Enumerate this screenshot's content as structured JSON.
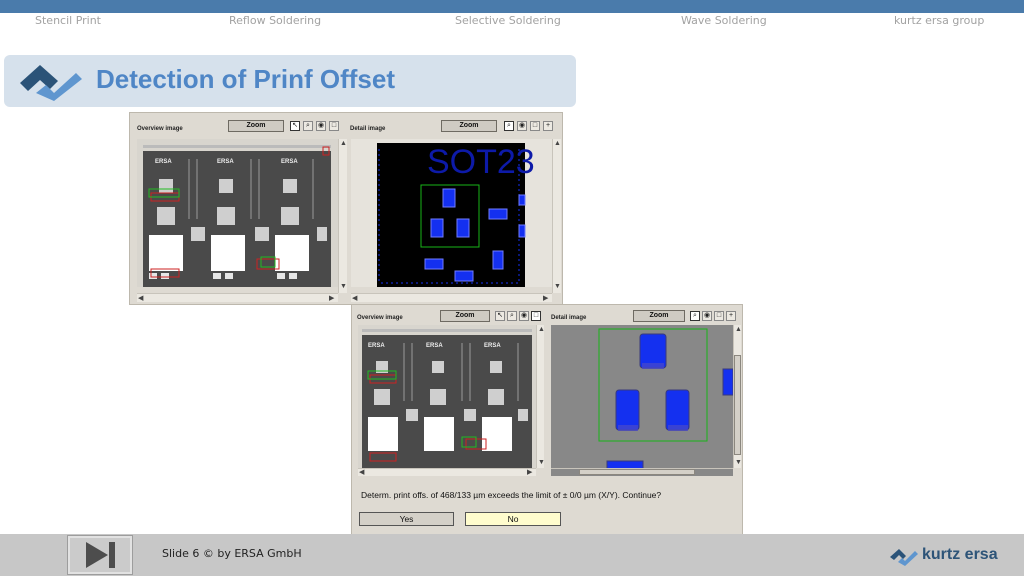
{
  "nav": {
    "items": [
      "Stencil Print",
      "Reflow Soldering",
      "Selective Soldering",
      "Wave Soldering",
      "kurtz ersa group"
    ]
  },
  "title": "Detection of Prinf Offset",
  "panel_top": {
    "overview_label": "Overview image",
    "detail_label": "Detail image",
    "zoom_label": "Zoom",
    "detail_text": "SOT23"
  },
  "panel_bottom": {
    "overview_label": "Overview image",
    "detail_label": "Detail image",
    "zoom_label": "Zoom",
    "message": "Determ. print offs. of 468/133 µm exceeds the limit of ± 0/0 µm (X/Y). Continue?",
    "yes_label": "Yes",
    "no_label": "No"
  },
  "board": {
    "brand_label": "ERSA"
  },
  "footer": {
    "slide_text": "Slide  6 © by ERSA GmbH",
    "brand": "kurtz ersa"
  },
  "colors": {
    "topbar": "#4a7bab",
    "title_text": "#4f86c6",
    "pad_blue": "#1430f0",
    "dialog_no": "#fffccd"
  }
}
